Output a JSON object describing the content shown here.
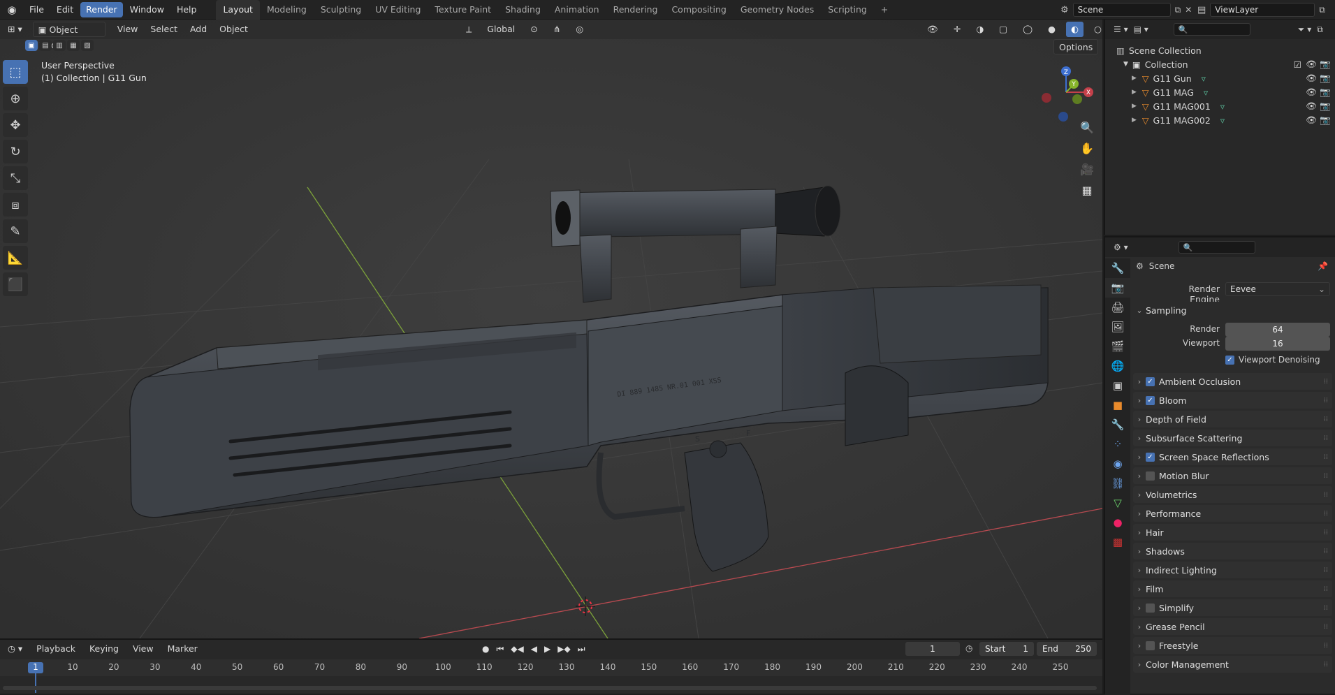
{
  "menus": [
    "File",
    "Edit",
    "Render",
    "Window",
    "Help"
  ],
  "active_menu": "Render",
  "workspaces": [
    "Layout",
    "Modeling",
    "Sculpting",
    "UV Editing",
    "Texture Paint",
    "Shading",
    "Animation",
    "Rendering",
    "Compositing",
    "Geometry Nodes",
    "Scripting"
  ],
  "active_workspace": "Layout",
  "add_workspace": "+",
  "scene_name": "Scene",
  "view_layer": "ViewLayer",
  "viewport": {
    "mode": "Object Mode",
    "menus": [
      "View",
      "Select",
      "Add",
      "Object"
    ],
    "orientation": "Global",
    "options": "Options",
    "perspective": "User Perspective",
    "collection_line": "(1) Collection | G11 Gun",
    "axes": {
      "x": "X",
      "y": "Y",
      "z": "Z"
    }
  },
  "model_engraving": "DI 889 1485 NR.01 001 XSS",
  "selector_marks": {
    "safe": "S",
    "fire": "F"
  },
  "outliner": {
    "root": "Scene Collection",
    "collection": "Collection",
    "objects": [
      "G11 Gun",
      "G11 MAG",
      "G11 MAG001",
      "G11 MAG002"
    ]
  },
  "properties": {
    "context": "Scene",
    "render_engine_label": "Render Engine",
    "render_engine": "Eevee",
    "sampling": {
      "label": "Sampling",
      "render_label": "Render",
      "render": "64",
      "viewport_label": "Viewport",
      "viewport": "16",
      "denoise_label": "Viewport Denoising",
      "denoise": true
    },
    "panels": [
      {
        "label": "Ambient Occlusion",
        "checkbox": true,
        "checked": true
      },
      {
        "label": "Bloom",
        "checkbox": true,
        "checked": true
      },
      {
        "label": "Depth of Field",
        "checkbox": false,
        "checked": false
      },
      {
        "label": "Subsurface Scattering",
        "checkbox": false,
        "checked": false
      },
      {
        "label": "Screen Space Reflections",
        "checkbox": true,
        "checked": true
      },
      {
        "label": "Motion Blur",
        "checkbox": true,
        "checked": false
      },
      {
        "label": "Volumetrics",
        "checkbox": false,
        "checked": false
      },
      {
        "label": "Performance",
        "checkbox": false,
        "checked": false
      },
      {
        "label": "Hair",
        "checkbox": false,
        "checked": false
      },
      {
        "label": "Shadows",
        "checkbox": false,
        "checked": false
      },
      {
        "label": "Indirect Lighting",
        "checkbox": false,
        "checked": false
      },
      {
        "label": "Film",
        "checkbox": false,
        "checked": false
      },
      {
        "label": "Simplify",
        "checkbox": true,
        "checked": false
      },
      {
        "label": "Grease Pencil",
        "checkbox": false,
        "checked": false
      },
      {
        "label": "Freestyle",
        "checkbox": true,
        "checked": false
      },
      {
        "label": "Color Management",
        "checkbox": false,
        "checked": false
      }
    ]
  },
  "timeline": {
    "menus": [
      "Playback",
      "Keying",
      "View",
      "Marker"
    ],
    "current_frame": "1",
    "start_label": "Start",
    "start": "1",
    "end_label": "End",
    "end": "250",
    "ticks": [
      "1",
      "10",
      "20",
      "30",
      "40",
      "50",
      "60",
      "70",
      "80",
      "90",
      "100",
      "110",
      "120",
      "130",
      "140",
      "150",
      "160",
      "170",
      "180",
      "190",
      "200",
      "210",
      "220",
      "230",
      "240",
      "250"
    ]
  },
  "colors": {
    "accent": "#4772b3",
    "x_axis": "#c4404a",
    "y_axis": "#86b52a",
    "z_axis": "#3d6fd1",
    "gun": "#3f4348",
    "background": "#3a3a3a"
  }
}
